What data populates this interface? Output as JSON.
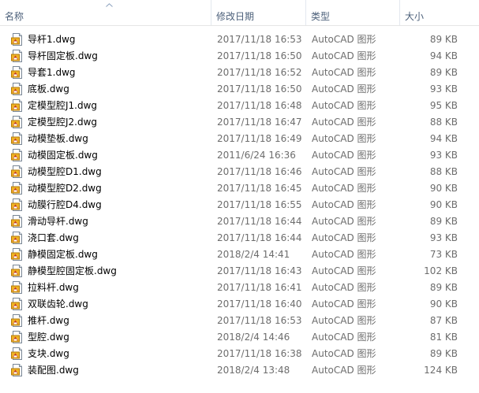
{
  "columns": {
    "name": "名称",
    "date": "修改日期",
    "type": "类型",
    "size": "大小"
  },
  "files": [
    {
      "name": "导杆1.dwg",
      "date": "2017/11/18 16:53",
      "type": "AutoCAD 图形",
      "size": "89 KB"
    },
    {
      "name": "导杆固定板.dwg",
      "date": "2017/11/18 16:50",
      "type": "AutoCAD 图形",
      "size": "94 KB"
    },
    {
      "name": "导套1.dwg",
      "date": "2017/11/18 16:52",
      "type": "AutoCAD 图形",
      "size": "89 KB"
    },
    {
      "name": "底板.dwg",
      "date": "2017/11/18 16:50",
      "type": "AutoCAD 图形",
      "size": "93 KB"
    },
    {
      "name": "定模型腔J1.dwg",
      "date": "2017/11/18 16:48",
      "type": "AutoCAD 图形",
      "size": "95 KB"
    },
    {
      "name": "定模型腔J2.dwg",
      "date": "2017/11/18 16:47",
      "type": "AutoCAD 图形",
      "size": "88 KB"
    },
    {
      "name": "动模垫板.dwg",
      "date": "2017/11/18 16:49",
      "type": "AutoCAD 图形",
      "size": "94 KB"
    },
    {
      "name": "动模固定板.dwg",
      "date": "2011/6/24 16:36",
      "type": "AutoCAD 图形",
      "size": "93 KB"
    },
    {
      "name": "动模型腔D1.dwg",
      "date": "2017/11/18 16:46",
      "type": "AutoCAD 图形",
      "size": "88 KB"
    },
    {
      "name": "动模型腔D2.dwg",
      "date": "2017/11/18 16:45",
      "type": "AutoCAD 图形",
      "size": "90 KB"
    },
    {
      "name": "动膜行腔D4.dwg",
      "date": "2017/11/18 16:55",
      "type": "AutoCAD 图形",
      "size": "90 KB"
    },
    {
      "name": "滑动导杆.dwg",
      "date": "2017/11/18 16:44",
      "type": "AutoCAD 图形",
      "size": "89 KB"
    },
    {
      "name": "浇口套.dwg",
      "date": "2017/11/18 16:44",
      "type": "AutoCAD 图形",
      "size": "93 KB"
    },
    {
      "name": "静模固定板.dwg",
      "date": "2018/2/4 14:41",
      "type": "AutoCAD 图形",
      "size": "73 KB"
    },
    {
      "name": "静模型腔固定板.dwg",
      "date": "2017/11/18 16:43",
      "type": "AutoCAD 图形",
      "size": "102 KB"
    },
    {
      "name": "拉料杆.dwg",
      "date": "2017/11/18 16:41",
      "type": "AutoCAD 图形",
      "size": "89 KB"
    },
    {
      "name": "双联齿轮.dwg",
      "date": "2017/11/18 16:40",
      "type": "AutoCAD 图形",
      "size": "90 KB"
    },
    {
      "name": "推杆.dwg",
      "date": "2017/11/18 16:53",
      "type": "AutoCAD 图形",
      "size": "87 KB"
    },
    {
      "name": "型腔.dwg",
      "date": "2018/2/4 14:46",
      "type": "AutoCAD 图形",
      "size": "81 KB"
    },
    {
      "name": "支块.dwg",
      "date": "2017/11/18 16:38",
      "type": "AutoCAD 图形",
      "size": "89 KB"
    },
    {
      "name": "装配图.dwg",
      "date": "2018/2/4 13:48",
      "type": "AutoCAD 图形",
      "size": "124 KB"
    }
  ],
  "icon": "dwg-file-icon",
  "sort_indicator": "sort-ascending-icon"
}
